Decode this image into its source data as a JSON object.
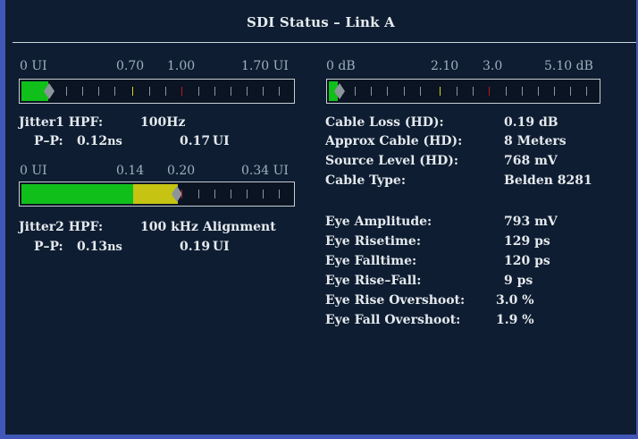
{
  "title": "SDI Status – Link A",
  "colors": {
    "background": "#0e1d31",
    "border": "#4157b8",
    "green": "#11bf1b",
    "yellow": "#c6c313",
    "red": "#c01818"
  },
  "jitter1": {
    "scale": [
      "0 UI",
      "0.70",
      "1.00",
      "1.70 UI"
    ],
    "reading_ui": 0.17,
    "header_label": "Jitter1 HPF:",
    "header_value": "100Hz",
    "pp_label": "P–P:",
    "pp_ns": "0.12",
    "pp_ns_unit": "ns",
    "pp_ui": "0.17",
    "pp_ui_unit": "UI"
  },
  "jitter2": {
    "scale": [
      "0 UI",
      "0.14",
      "0.20",
      "0.34 UI"
    ],
    "reading_ui": 0.19,
    "header_label": "Jitter2 HPF:",
    "header_value": "100 kHz Alignment",
    "pp_label": "P–P:",
    "pp_ns": "0.13",
    "pp_ns_unit": "ns",
    "pp_ui": "0.19",
    "pp_ui_unit": "UI"
  },
  "cable_meter": {
    "scale": [
      "0 dB",
      "2.10",
      "3.0",
      "5.10 dB"
    ],
    "reading_db": 0.19
  },
  "cable_info": [
    {
      "label": "Cable Loss (HD):",
      "value": "0.19 dB"
    },
    {
      "label": "Approx Cable (HD):",
      "value": "8 Meters"
    },
    {
      "label": "Source Level (HD):",
      "value": "768 mV"
    },
    {
      "label": "Cable Type:",
      "value": "Belden 8281"
    }
  ],
  "eye_info": [
    {
      "label": "Eye Amplitude:",
      "value": "793 mV"
    },
    {
      "label": "Eye Risetime:",
      "value": "129 ps"
    },
    {
      "label": "Eye Falltime:",
      "value": "120 ps"
    },
    {
      "label": "Eye Rise–Fall:",
      "value": "9 ps"
    },
    {
      "label": "Eye Rise Overshoot:",
      "value": "3.0 %"
    },
    {
      "label": "Eye Fall Overshoot:",
      "value": "1.9 %"
    }
  ]
}
